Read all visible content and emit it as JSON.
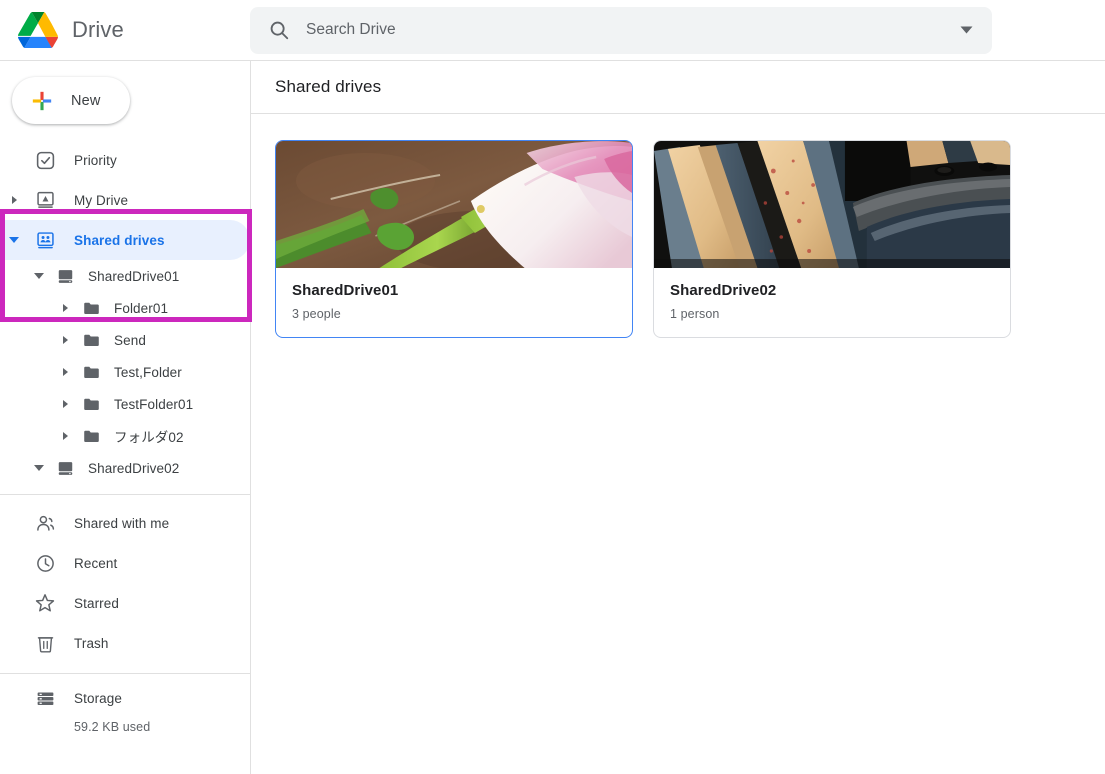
{
  "app": {
    "brand_name": "Drive",
    "logo_icon": "google-drive-logo"
  },
  "search": {
    "placeholder": "Search Drive",
    "value": "",
    "icon": "search-icon",
    "options_icon": "chevron-down-icon"
  },
  "sidebar": {
    "new_button": {
      "label": "New",
      "icon": "plus-icon"
    },
    "nav": [
      {
        "label": "Priority",
        "icon": "check-circle-icon",
        "expandable": false,
        "active": false
      },
      {
        "label": "My Drive",
        "icon": "my-drive-icon",
        "expandable": true,
        "expanded": false,
        "active": false
      },
      {
        "label": "Shared drives",
        "icon": "shared-drives-icon",
        "expandable": true,
        "expanded": true,
        "active": true
      }
    ],
    "tree": [
      {
        "label": "SharedDrive01",
        "icon": "drive-icon",
        "depth": 1,
        "expanded": true
      },
      {
        "label": "Folder01",
        "icon": "folder-icon",
        "depth": 2,
        "expanded": false
      },
      {
        "label": "Send",
        "icon": "folder-icon",
        "depth": 2,
        "expanded": false
      },
      {
        "label": "Test,Folder",
        "icon": "folder-icon",
        "depth": 2,
        "expanded": false
      },
      {
        "label": "TestFolder01",
        "icon": "folder-icon",
        "depth": 2,
        "expanded": false
      },
      {
        "label": "フォルダ02",
        "icon": "folder-icon",
        "depth": 2,
        "expanded": false
      },
      {
        "label": "SharedDrive02",
        "icon": "drive-icon",
        "depth": 1,
        "expanded": true
      }
    ],
    "nav_bottom": [
      {
        "label": "Shared with me",
        "icon": "people-icon"
      },
      {
        "label": "Recent",
        "icon": "clock-icon"
      },
      {
        "label": "Starred",
        "icon": "star-icon"
      },
      {
        "label": "Trash",
        "icon": "trash-icon"
      }
    ],
    "storage": {
      "label": "Storage",
      "icon": "storage-icon",
      "used_text": "59.2 KB used"
    }
  },
  "main": {
    "title": "Shared drives",
    "cards": [
      {
        "name": "SharedDrive01",
        "members": "3 people",
        "thumbnail": "tulip-flower-photo",
        "selected": true
      },
      {
        "name": "SharedDrive02",
        "members": "1 person",
        "thumbnail": "old-books-photo",
        "selected": false
      }
    ]
  },
  "annotation": {
    "color": "#cc28bd",
    "target": "shared-drives-tree-region"
  }
}
